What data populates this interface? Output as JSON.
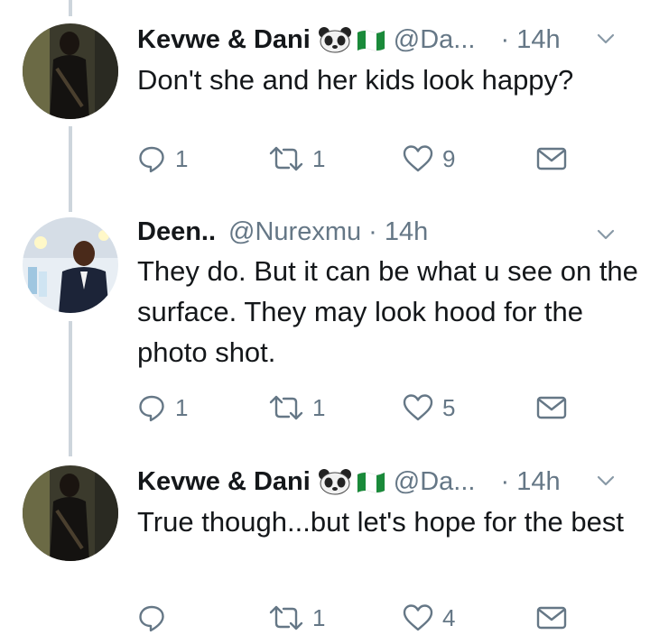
{
  "tweets": [
    {
      "name": "Kevwe & Dani",
      "emoji": [
        "panda-emoji",
        "nigeria-flag-emoji"
      ],
      "handle": "@Da...",
      "time": "· 14h",
      "text": "Don't she and her kids look happy?",
      "replies": "1",
      "retweets": "1",
      "likes": "9"
    },
    {
      "name": "Deen..",
      "handle": "@Nurexmu",
      "time": "· 14h",
      "text": "They do. But it can be what u see on the surface. They may look hood for the photo shot.",
      "replies": "1",
      "retweets": "1",
      "likes": "5"
    },
    {
      "name": "Kevwe & Dani",
      "emoji": [
        "panda-emoji",
        "nigeria-flag-emoji"
      ],
      "handle": "@Da...",
      "time": "· 14h",
      "text": "True though...but let's hope for the best",
      "replies": "",
      "retweets": "1",
      "likes": "4"
    }
  ],
  "colors": {
    "text": "#14171a",
    "secondary": "#657786",
    "thread_line": "#cdd5dc",
    "background": "#ffffff"
  }
}
